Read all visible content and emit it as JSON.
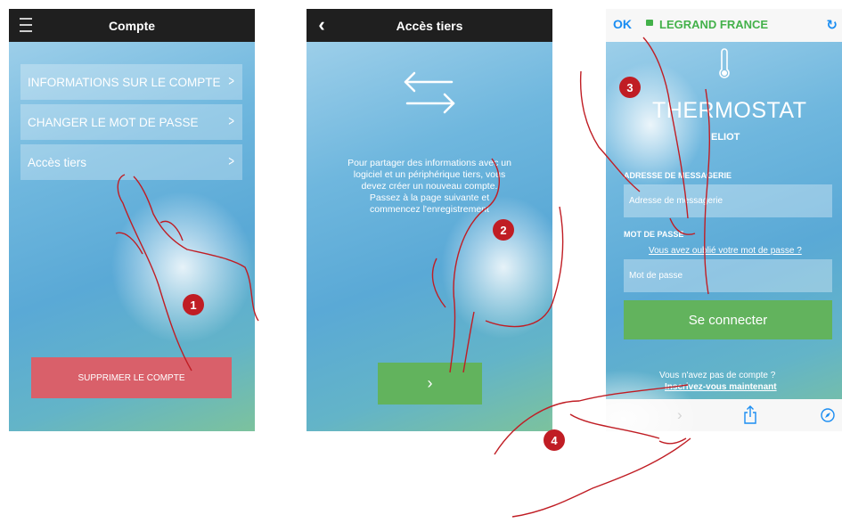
{
  "screen1": {
    "title": "Compte",
    "menu_items": [
      {
        "label": "INFORMATIONS SUR LE COMPTE"
      },
      {
        "label": "CHANGER LE MOT DE PASSE"
      },
      {
        "label": "Accès tiers"
      }
    ],
    "delete_label": "SUPPRIMER LE COMPTE"
  },
  "screen2": {
    "title": "Accès tiers",
    "info_lines": [
      "Pour partager des informations avec un",
      "logiciel et un périphérique tiers, vous",
      "devez créer un nouveau compte.",
      "Passez à la page suivante et",
      "commencez l'enregistrement"
    ],
    "next_label": "›"
  },
  "screen3": {
    "ok_label": "OK",
    "domain": "LEGRAND FRANCE",
    "logo_text": "THERMOSTAT",
    "logo_sub": "ELIOT",
    "email_label": "ADRESSE DE MESSAGERIE",
    "email_placeholder": "Adresse de messagerie",
    "password_label": "MOT DE PASSE",
    "forgot_link": "Vous avez oublié votre mot de passe ?",
    "password_placeholder": "Mot de passe",
    "login_label": "Se connecter",
    "no_account": "Vous n'avez pas de compte ?",
    "register_link": "Inscrivez-vous maintenant"
  },
  "steps": [
    "1",
    "2",
    "3",
    "4"
  ],
  "colors": {
    "badge": "#c01d24",
    "delete_button": "#d9606a",
    "green_button": "#62b35d",
    "link_blue": "#1a8df2",
    "lock_green": "#43b14a"
  },
  "icons": [
    "menu-icon",
    "back-chevron-icon",
    "swap-arrows-icon",
    "lock-icon",
    "reload-icon",
    "thermometer-icon",
    "share-icon",
    "compass-icon"
  ]
}
